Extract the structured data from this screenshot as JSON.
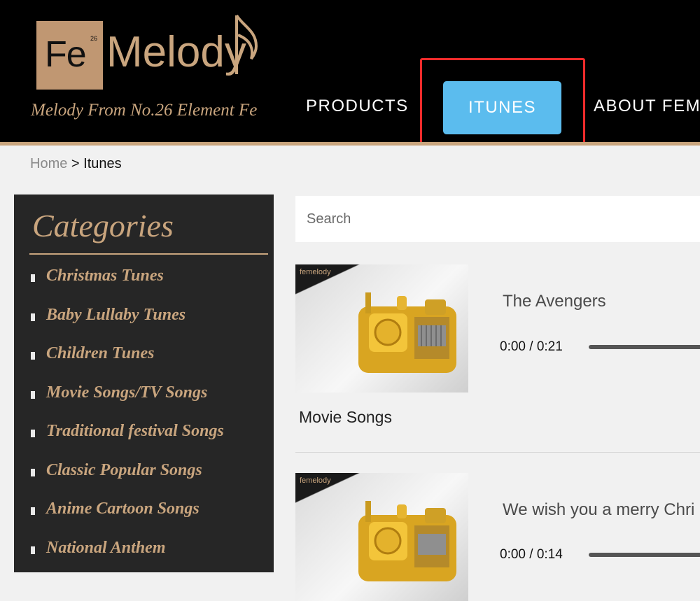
{
  "brand": {
    "logo_element": "Fe",
    "logo_number": "26",
    "logo_name": "Melody",
    "tagline": "Melody From No.26 Element Fe",
    "accent_color": "#c9a57e"
  },
  "nav": {
    "items": [
      {
        "label": "PRODUCTS",
        "active": false
      },
      {
        "label": "ITUNES",
        "active": true
      },
      {
        "label": "ABOUT FEM"
      }
    ],
    "active_color": "#5bbcee",
    "highlight_color": "#ef2b2b"
  },
  "breadcrumb": {
    "home": "Home",
    "separator": ">",
    "current": "Itunes"
  },
  "sidebar": {
    "title": "Categories",
    "items": [
      {
        "label": "Christmas Tunes"
      },
      {
        "label": "Baby Lullaby Tunes"
      },
      {
        "label": "Children Tunes"
      },
      {
        "label": "Movie Songs/TV Songs"
      },
      {
        "label": "Traditional festival Songs"
      },
      {
        "label": "Classic Popular Songs"
      },
      {
        "label": "Anime Cartoon Songs"
      },
      {
        "label": "National Anthem"
      }
    ]
  },
  "search": {
    "placeholder": "Search",
    "value": ""
  },
  "tracks": [
    {
      "title": "The Avengers",
      "time": "0:00 / 0:21",
      "category": "Movie Songs",
      "thumb_logo": "femelody"
    },
    {
      "title": "We wish you a merry Chri",
      "time": "0:00 / 0:14",
      "thumb_logo": "femelody"
    }
  ]
}
